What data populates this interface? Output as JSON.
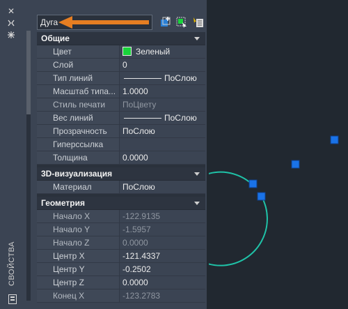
{
  "palette": {
    "title": "СВОЙСТВА",
    "object_type": "Дуга"
  },
  "sections": [
    {
      "title": "Общие",
      "rows": [
        {
          "label": "Цвет",
          "value": "Зеленый",
          "kind": "color"
        },
        {
          "label": "Слой",
          "value": "0"
        },
        {
          "label": "Тип линий",
          "value": "ПоСлою",
          "kind": "line"
        },
        {
          "label": "Масштаб типа...",
          "value": "1.0000"
        },
        {
          "label": "Стиль печати",
          "value": "ПоЦвету",
          "readonly": true
        },
        {
          "label": "Вес линий",
          "value": "ПоСлою",
          "kind": "line"
        },
        {
          "label": "Прозрачность",
          "value": "ПоСлою"
        },
        {
          "label": "Гиперссылка",
          "value": ""
        },
        {
          "label": "Толщина",
          "value": "0.0000"
        }
      ]
    },
    {
      "title": "3D-визуализация",
      "rows": [
        {
          "label": "Материал",
          "value": "ПоСлою"
        }
      ]
    },
    {
      "title": "Геометрия",
      "rows": [
        {
          "label": "Начало X",
          "value": "-122.9135",
          "readonly": true
        },
        {
          "label": "Начало Y",
          "value": "-1.5957",
          "readonly": true
        },
        {
          "label": "Начало Z",
          "value": "0.0000",
          "readonly": true
        },
        {
          "label": "Центр X",
          "value": "-121.4337"
        },
        {
          "label": "Центр Y",
          "value": "-0.2502"
        },
        {
          "label": "Центр Z",
          "value": "0.0000"
        },
        {
          "label": "Конец X",
          "value": "-123.2783",
          "readonly": true
        }
      ]
    }
  ],
  "colors": {
    "accent_arrow": "#e67e22",
    "swatch_green": "#19d43b",
    "arc_color": "#1fc3a8",
    "grip_color": "#1a73e8",
    "background": "#212830",
    "panel": "#3b4453"
  }
}
